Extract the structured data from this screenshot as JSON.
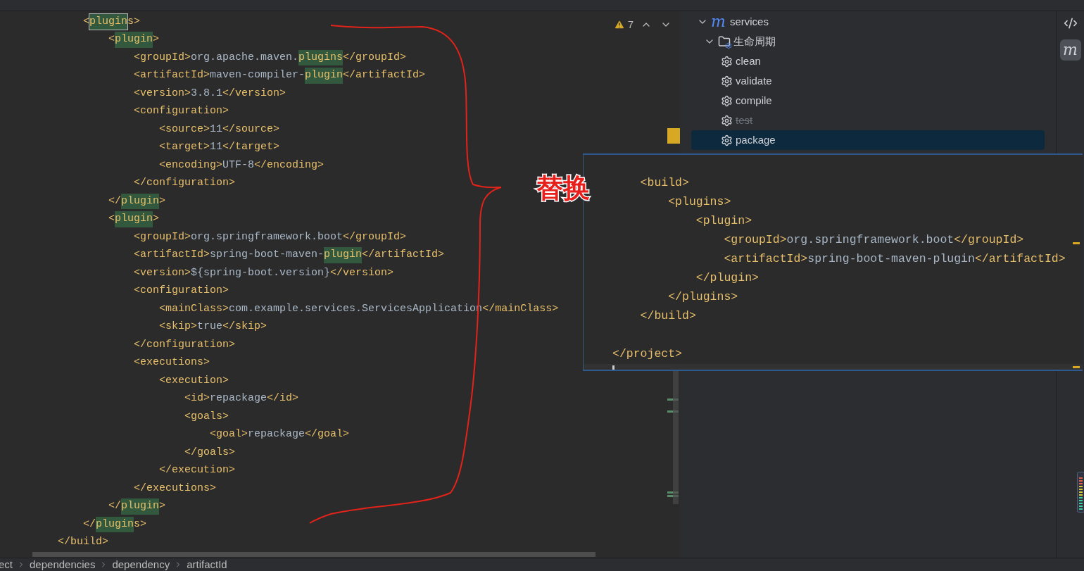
{
  "editor": {
    "problems": {
      "count": "7"
    },
    "lines": [
      {
        "parts": [
          {
            "kind": "tag",
            "text": "            <"
          },
          {
            "kind": "current-match",
            "text": "plugin"
          },
          {
            "kind": "tag",
            "text": "s>"
          }
        ]
      },
      {
        "parts": [
          {
            "kind": "tag",
            "text": "                <"
          },
          {
            "kind": "match",
            "text": "plugin"
          },
          {
            "kind": "tag",
            "text": ">"
          }
        ]
      },
      {
        "parts": [
          {
            "kind": "tag",
            "text": "                    <groupId>"
          },
          {
            "kind": "value",
            "text": "org.apache.maven."
          },
          {
            "kind": "match",
            "text": "plugins"
          },
          {
            "kind": "tag",
            "text": "</groupId>"
          }
        ]
      },
      {
        "parts": [
          {
            "kind": "tag",
            "text": "                    <artifactId>"
          },
          {
            "kind": "value",
            "text": "maven-compiler-"
          },
          {
            "kind": "match",
            "text": "plugin"
          },
          {
            "kind": "tag",
            "text": "</artifactId>"
          }
        ]
      },
      {
        "parts": [
          {
            "kind": "tag",
            "text": "                    <version>"
          },
          {
            "kind": "value",
            "text": "3.8.1"
          },
          {
            "kind": "tag",
            "text": "</version>"
          }
        ]
      },
      {
        "parts": [
          {
            "kind": "tag",
            "text": "                    <configuration>"
          }
        ]
      },
      {
        "parts": [
          {
            "kind": "tag",
            "text": "                        <source>"
          },
          {
            "kind": "value",
            "text": "11"
          },
          {
            "kind": "tag",
            "text": "</source>"
          }
        ]
      },
      {
        "parts": [
          {
            "kind": "tag",
            "text": "                        <target>"
          },
          {
            "kind": "value",
            "text": "11"
          },
          {
            "kind": "tag",
            "text": "</target>"
          }
        ]
      },
      {
        "parts": [
          {
            "kind": "tag",
            "text": "                        <encoding>"
          },
          {
            "kind": "value",
            "text": "UTF-8"
          },
          {
            "kind": "tag",
            "text": "</encoding>"
          }
        ]
      },
      {
        "parts": [
          {
            "kind": "tag",
            "text": "                    </configuration>"
          }
        ]
      },
      {
        "parts": [
          {
            "kind": "tag",
            "text": "                </"
          },
          {
            "kind": "match",
            "text": "plugin"
          },
          {
            "kind": "tag",
            "text": ">"
          }
        ]
      },
      {
        "parts": [
          {
            "kind": "tag",
            "text": "                <"
          },
          {
            "kind": "match",
            "text": "plugin"
          },
          {
            "kind": "tag",
            "text": ">"
          }
        ]
      },
      {
        "parts": [
          {
            "kind": "tag",
            "text": "                    <groupId>"
          },
          {
            "kind": "value",
            "text": "org.springframework.boot"
          },
          {
            "kind": "tag",
            "text": "</groupId>"
          }
        ]
      },
      {
        "parts": [
          {
            "kind": "tag",
            "text": "                    <artifactId>"
          },
          {
            "kind": "value",
            "text": "spring-boot-maven-"
          },
          {
            "kind": "match",
            "text": "plugin"
          },
          {
            "kind": "tag",
            "text": "</artifactId>"
          }
        ]
      },
      {
        "parts": [
          {
            "kind": "tag",
            "text": "                    <version>"
          },
          {
            "kind": "value",
            "text": "${spring-boot.version}"
          },
          {
            "kind": "tag",
            "text": "</version>"
          }
        ]
      },
      {
        "parts": [
          {
            "kind": "tag",
            "text": "                    <configuration>"
          }
        ]
      },
      {
        "parts": [
          {
            "kind": "tag",
            "text": "                        <mainClass>"
          },
          {
            "kind": "value",
            "text": "com.example.services.ServicesApplication"
          },
          {
            "kind": "tag",
            "text": "</mainClass>"
          }
        ]
      },
      {
        "parts": [
          {
            "kind": "tag",
            "text": "                        <skip>"
          },
          {
            "kind": "value",
            "text": "true"
          },
          {
            "kind": "tag",
            "text": "</skip>"
          }
        ]
      },
      {
        "parts": [
          {
            "kind": "tag",
            "text": "                    </configuration>"
          }
        ]
      },
      {
        "parts": [
          {
            "kind": "tag",
            "text": "                    <executions>"
          }
        ]
      },
      {
        "parts": [
          {
            "kind": "tag",
            "text": "                        <execution>"
          }
        ]
      },
      {
        "parts": [
          {
            "kind": "tag",
            "text": "                            <id>"
          },
          {
            "kind": "value",
            "text": "repackage"
          },
          {
            "kind": "tag",
            "text": "</id>"
          }
        ]
      },
      {
        "parts": [
          {
            "kind": "tag",
            "text": "                            <goals>"
          }
        ]
      },
      {
        "parts": [
          {
            "kind": "tag",
            "text": "                                <goal>"
          },
          {
            "kind": "value",
            "text": "repackage"
          },
          {
            "kind": "tag",
            "text": "</goal>"
          }
        ]
      },
      {
        "parts": [
          {
            "kind": "tag",
            "text": "                            </goals>"
          }
        ]
      },
      {
        "parts": [
          {
            "kind": "tag",
            "text": "                        </execution>"
          }
        ]
      },
      {
        "parts": [
          {
            "kind": "tag",
            "text": "                    </executions>"
          }
        ]
      },
      {
        "parts": [
          {
            "kind": "tag",
            "text": "                </"
          },
          {
            "kind": "match",
            "text": "plugin"
          },
          {
            "kind": "tag",
            "text": ">"
          }
        ]
      },
      {
        "parts": [
          {
            "kind": "tag",
            "text": "            </"
          },
          {
            "kind": "match",
            "text": "plugin"
          },
          {
            "kind": "tag",
            "text": "s>"
          }
        ]
      },
      {
        "parts": [
          {
            "kind": "tag",
            "text": "        </build>"
          }
        ]
      }
    ]
  },
  "annotation": {
    "label": "替换"
  },
  "popup": {
    "lines": [
      {
        "kind": "blank"
      },
      {
        "kind": "code",
        "parts": [
          {
            "kind": "tag",
            "text": "    <build>"
          }
        ]
      },
      {
        "kind": "code",
        "parts": [
          {
            "kind": "tag",
            "text": "        <plugins>"
          }
        ]
      },
      {
        "kind": "code",
        "parts": [
          {
            "kind": "tag",
            "text": "            <plugin>"
          }
        ]
      },
      {
        "kind": "code",
        "parts": [
          {
            "kind": "tag",
            "text": "                <groupId>"
          },
          {
            "kind": "value",
            "text": "org.springframework.boot"
          },
          {
            "kind": "tag",
            "text": "</groupId>"
          }
        ]
      },
      {
        "kind": "code",
        "parts": [
          {
            "kind": "tag",
            "text": "                <artifactId>"
          },
          {
            "kind": "value",
            "text": "spring-boot-maven-plugin"
          },
          {
            "kind": "tag",
            "text": "</artifactId>"
          }
        ]
      },
      {
        "kind": "code",
        "parts": [
          {
            "kind": "tag",
            "text": "            </plugin>"
          }
        ]
      },
      {
        "kind": "code",
        "parts": [
          {
            "kind": "tag",
            "text": "        </plugins>"
          }
        ]
      },
      {
        "kind": "code",
        "parts": [
          {
            "kind": "tag",
            "text": "    </build>"
          }
        ]
      },
      {
        "kind": "blank"
      },
      {
        "kind": "code",
        "parts": [
          {
            "kind": "tag",
            "text": "</project>"
          }
        ]
      },
      {
        "kind": "cursor"
      }
    ]
  },
  "maven_panel": {
    "tree": [
      {
        "label": "services",
        "kind": "project",
        "icon_text": "m",
        "expanded": true,
        "children": [
          {
            "label": "生命周期",
            "kind": "folder",
            "expanded": true,
            "children": [
              {
                "label": "clean",
                "kind": "goal",
                "disabled": false,
                "selected": false
              },
              {
                "label": "validate",
                "kind": "goal",
                "disabled": false,
                "selected": false
              },
              {
                "label": "compile",
                "kind": "goal",
                "disabled": false,
                "selected": false
              },
              {
                "label": "test",
                "kind": "goal",
                "disabled": true,
                "selected": false
              },
              {
                "label": "package",
                "kind": "goal",
                "disabled": false,
                "selected": true
              }
            ]
          }
        ]
      }
    ]
  },
  "tool_strip": [
    {
      "kind": "code",
      "selected": false
    },
    {
      "kind": "maven",
      "icon_text": "m",
      "selected": true
    }
  ],
  "breadcrumbs": [
    "ect",
    "dependencies",
    "dependency",
    "artifactId"
  ]
}
